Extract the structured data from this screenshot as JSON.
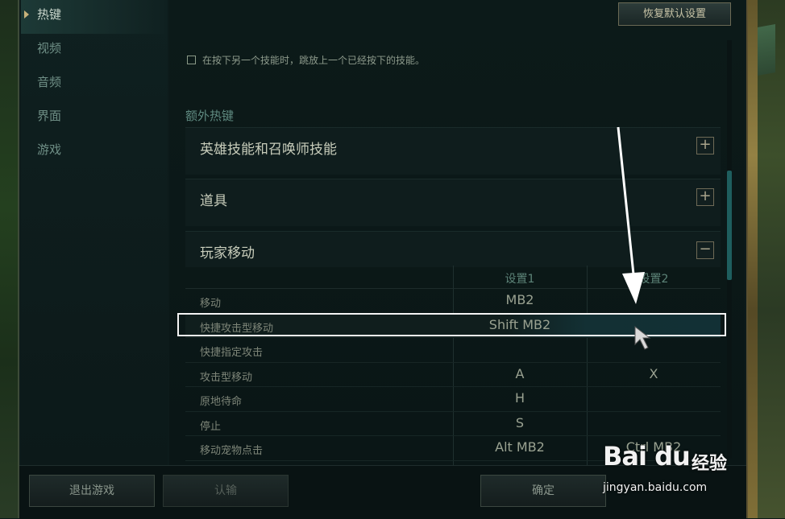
{
  "sidebar": {
    "items": [
      {
        "label": "热键",
        "active": true
      },
      {
        "label": "视频",
        "active": false
      },
      {
        "label": "音频",
        "active": false
      },
      {
        "label": "界面",
        "active": false
      },
      {
        "label": "游戏",
        "active": false
      }
    ]
  },
  "main": {
    "reset_button": "恢复默认设置",
    "checkbox_label": "在按下另一个技能时，跳放上一个已经按下的技能。",
    "checkbox_checked": false,
    "section_title": "额外热键",
    "groups": [
      {
        "label": "英雄技能和召唤师技能",
        "toggle": "+"
      },
      {
        "label": "道具",
        "toggle": "+"
      },
      {
        "label": "玩家移动",
        "toggle": "−"
      }
    ],
    "table": {
      "columns": [
        "设置1",
        "设置2"
      ],
      "rows": [
        {
          "name": "移动",
          "key1": "MB2",
          "key2": ""
        },
        {
          "name": "快捷攻击型移动",
          "key1": "Shift MB2",
          "key2": ""
        },
        {
          "name": "快捷指定攻击",
          "key1": "",
          "key2": ""
        },
        {
          "name": "攻击型移动",
          "key1": "A",
          "key2": "X"
        },
        {
          "name": "原地待命",
          "key1": "H",
          "key2": ""
        },
        {
          "name": "停止",
          "key1": "S",
          "key2": ""
        },
        {
          "name": "移动宠物点击",
          "key1": "Alt MB2",
          "key2": "Ctrl MB2"
        }
      ]
    }
  },
  "footer": {
    "exit_button": "退出游戏",
    "surrender_button": "认输",
    "confirm_button": "确定"
  },
  "watermark": {
    "logo": "Bai du",
    "text": "经验",
    "url": "jingyan.baidu.com"
  },
  "colors": {
    "accent_teal": "#1e5e5e",
    "highlight": "#f4f4f4",
    "gold_border": "#6b6a55"
  }
}
